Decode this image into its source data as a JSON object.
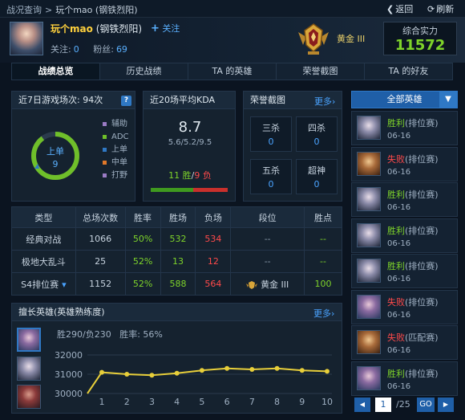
{
  "breadcrumb": {
    "root": "战况查询",
    "separator": ">",
    "current": "玩个mao (钢铁烈阳)"
  },
  "topbar": {
    "back_label": "返回",
    "close_label": "关注",
    "refresh_label": "刷新"
  },
  "player": {
    "name": "玩个mao",
    "server": "(钢铁烈阳)",
    "follow_label": "关注",
    "following_label": "关注:",
    "following_count": "0",
    "fans_label": "粉丝:",
    "fans_count": "69",
    "rank": "黄金 III",
    "power_label": "综合实力",
    "power_value": "11572"
  },
  "tabs": [
    "战绩总览",
    "历史战绩",
    "TA 的英雄",
    "荣誉截图",
    "TA 的好友"
  ],
  "recent_games": {
    "title": "近7日游戏场次: 94次",
    "role": "上单",
    "role_count": "9",
    "legend": [
      {
        "label": "辅助",
        "color": "#9a7bc4"
      },
      {
        "label": "ADC",
        "color": "#6fbf2a"
      },
      {
        "label": "上单",
        "color": "#2f78c4"
      },
      {
        "label": "中单",
        "color": "#e0782a"
      },
      {
        "label": "打野",
        "color": "#9a7bc4"
      }
    ],
    "ring_fraction": 0.9
  },
  "kda": {
    "title": "近20场平均KDA",
    "value": "8.7",
    "detail": "5.6/5.2/9.5",
    "wins": "11 胜",
    "separator": "/",
    "losses": "9 负",
    "win_fraction": 0.55
  },
  "honor": {
    "title": "荣誉截图",
    "more": "更多",
    "items": [
      {
        "label": "三杀",
        "count": "0"
      },
      {
        "label": "四杀",
        "count": "0"
      },
      {
        "label": "五杀",
        "count": "0"
      },
      {
        "label": "超神",
        "count": "0"
      }
    ]
  },
  "summary_table": {
    "headers": [
      "类型",
      "总场次数",
      "胜率",
      "胜场",
      "负场",
      "段位",
      "胜点"
    ],
    "rows": [
      {
        "type": "经典对战",
        "total": "1066",
        "rate": "50%",
        "wins": "532",
        "losses": "534",
        "tier": "--",
        "points": "--"
      },
      {
        "type": "极地大乱斗",
        "total": "25",
        "rate": "52%",
        "wins": "13",
        "losses": "12",
        "tier": "--",
        "points": "--"
      },
      {
        "type": "S4排位赛",
        "total": "1152",
        "rate": "52%",
        "wins": "588",
        "losses": "564",
        "tier": "黄金 III",
        "points": "100"
      }
    ]
  },
  "heroes_panel": {
    "title": "擅长英雄(英雄熟练度)",
    "more": "更多",
    "record": "胜290/负230",
    "winrate": "胜率: 56%"
  },
  "chart_data": {
    "type": "line",
    "x": [
      1,
      2,
      3,
      4,
      5,
      6,
      7,
      8,
      9,
      10
    ],
    "values": [
      31100,
      31000,
      30950,
      31050,
      31200,
      31300,
      31250,
      31300,
      31200,
      31150
    ],
    "yticks": [
      "32000",
      "31000",
      "30000"
    ],
    "ylim": [
      30000,
      32000
    ],
    "grid": true
  },
  "side": {
    "filter_label": "全部英雄",
    "matches": [
      {
        "result": "胜利",
        "mode": "(排位赛)",
        "date": "06-16",
        "win": true
      },
      {
        "result": "失败",
        "mode": "(排位赛)",
        "date": "06-16",
        "win": false
      },
      {
        "result": "胜利",
        "mode": "(排位赛)",
        "date": "06-16",
        "win": true
      },
      {
        "result": "胜利",
        "mode": "(排位赛)",
        "date": "06-16",
        "win": true
      },
      {
        "result": "胜利",
        "mode": "(排位赛)",
        "date": "06-16",
        "win": true
      },
      {
        "result": "失败",
        "mode": "(排位赛)",
        "date": "06-16",
        "win": false
      },
      {
        "result": "失败",
        "mode": "(匹配赛)",
        "date": "06-16",
        "win": false
      },
      {
        "result": "胜利",
        "mode": "(排位赛)",
        "date": "06-16",
        "win": true
      }
    ],
    "page": "1",
    "total": "/25",
    "go": "GO"
  }
}
